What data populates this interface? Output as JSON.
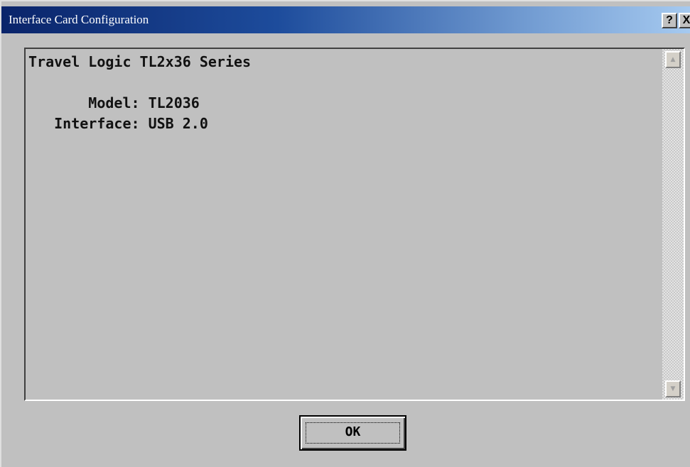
{
  "window": {
    "title": "Interface Card Configuration",
    "help_label": "?",
    "close_label": "X"
  },
  "content": {
    "lines": [
      "Travel Logic TL2x36 Series",
      "",
      "       Model: TL2036",
      "   Interface: USB 2.0"
    ]
  },
  "scrollbar": {
    "up_arrow": "▲",
    "down_arrow": "▼"
  },
  "buttons": {
    "ok_label": "OK"
  },
  "colors": {
    "titlebar_start": "#0a246a",
    "titlebar_end": "#a6caf0",
    "face": "#c0c0c0"
  },
  "icons": {
    "help": "help-icon",
    "close": "close-icon",
    "scroll_up": "arrow-up-icon",
    "scroll_down": "arrow-down-icon"
  }
}
